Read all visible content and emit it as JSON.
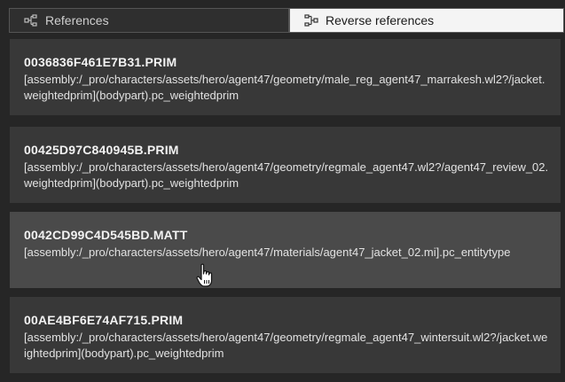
{
  "tabs": {
    "references_label": "References",
    "reverse_label": "Reverse references"
  },
  "items": [
    {
      "title": "0036836F461E7B31.PRIM",
      "path": "[assembly:/_pro/characters/assets/hero/agent47/geometry/male_reg_agent47_marrakesh.wl2?/jacket.weightedprim](bodypart).pc_weightedprim"
    },
    {
      "title": "00425D97C840945B.PRIM",
      "path": "[assembly:/_pro/characters/assets/hero/agent47/geometry/regmale_agent47.wl2?/agent47_review_02.weightedprim](bodypart).pc_weightedprim"
    },
    {
      "title": "0042CD99C4D545BD.MATT",
      "path": "[assembly:/_pro/characters/assets/hero/agent47/materials/agent47_jacket_02.mi].pc_entitytype"
    },
    {
      "title": "00AE4BF6E74AF715.PRIM",
      "path": "[assembly:/_pro/characters/assets/hero/agent47/geometry/regmale_agent47_wintersuit.wl2?/jacket.weightedprim](bodypart).pc_weightedprim"
    }
  ],
  "colors": {
    "background": "#262626",
    "card": "#383838",
    "card_hover": "#4a4a4a",
    "active_tab": "#f4f4f4"
  }
}
